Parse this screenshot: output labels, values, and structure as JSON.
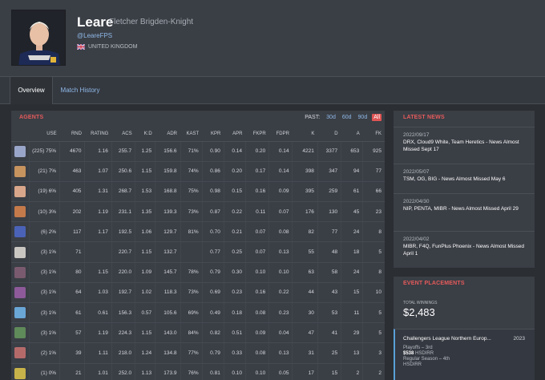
{
  "player": {
    "alias": "Leare",
    "real_name": "Fletcher Brigden-Knight",
    "twitter": "@LeareFPS",
    "country": "UNITED KINGDOM"
  },
  "tabs": [
    {
      "label": "Overview",
      "active": true
    },
    {
      "label": "Match History",
      "active": false
    }
  ],
  "agents": {
    "title": "AGENTS",
    "past_label": "PAST:",
    "past_options": [
      "30d",
      "60d",
      "90d",
      "All"
    ],
    "past_selected": "All",
    "columns": [
      "",
      "USE",
      "RND",
      "RATING",
      "ACS",
      "K:D",
      "ADR",
      "KAST",
      "KPR",
      "APR",
      "FKPR",
      "FDPR",
      "K",
      "D",
      "A",
      "FK"
    ],
    "rows": [
      {
        "icon": "sova-icon",
        "color": "#9aa6c9",
        "use": "(225) 75%",
        "rnd": "4670",
        "rating": "1.16",
        "acs": "255.7",
        "kd": "1.25",
        "adr": "156.6",
        "kast": "71%",
        "kpr": "0.90",
        "apr": "0.14",
        "fkpr": "0.20",
        "fdpr": "0.14",
        "k": "4221",
        "d": "3377",
        "a": "653",
        "fk": "925"
      },
      {
        "icon": "breach-icon",
        "color": "#c7935e",
        "use": "(21) 7%",
        "rnd": "463",
        "rating": "1.07",
        "acs": "250.6",
        "kd": "1.15",
        "adr": "159.8",
        "kast": "74%",
        "kpr": "0.86",
        "apr": "0.20",
        "fkpr": "0.17",
        "fdpr": "0.14",
        "k": "398",
        "d": "347",
        "a": "94",
        "fk": "77"
      },
      {
        "icon": "skye-icon",
        "color": "#d8a68a",
        "use": "(19) 6%",
        "rnd": "405",
        "rating": "1.31",
        "acs": "268.7",
        "kd": "1.53",
        "adr": "168.8",
        "kast": "75%",
        "kpr": "0.98",
        "apr": "0.15",
        "fkpr": "0.16",
        "fdpr": "0.09",
        "k": "395",
        "d": "259",
        "a": "61",
        "fk": "66"
      },
      {
        "icon": "kayo-icon",
        "color": "#c47a4a",
        "use": "(10) 3%",
        "rnd": "202",
        "rating": "1.19",
        "acs": "231.1",
        "kd": "1.35",
        "adr": "139.3",
        "kast": "73%",
        "kpr": "0.87",
        "apr": "0.22",
        "fkpr": "0.11",
        "fdpr": "0.07",
        "k": "176",
        "d": "130",
        "a": "45",
        "fk": "23"
      },
      {
        "icon": "neon-icon",
        "color": "#4a63b8",
        "use": "(6) 2%",
        "rnd": "117",
        "rating": "1.17",
        "acs": "192.5",
        "kd": "1.06",
        "adr": "129.7",
        "kast": "81%",
        "kpr": "0.70",
        "apr": "0.21",
        "fkpr": "0.07",
        "fdpr": "0.08",
        "k": "82",
        "d": "77",
        "a": "24",
        "fk": "8"
      },
      {
        "icon": "sage-icon",
        "color": "#c9c6c2",
        "use": "(3) 1%",
        "rnd": "71",
        "rating": "",
        "acs": "220.7",
        "kd": "1.15",
        "adr": "132.7",
        "kast": "",
        "kpr": "0.77",
        "apr": "0.25",
        "fkpr": "0.07",
        "fdpr": "0.13",
        "k": "55",
        "d": "48",
        "a": "18",
        "fk": "5"
      },
      {
        "icon": "fade-icon",
        "color": "#7a5a6e",
        "use": "(3) 1%",
        "rnd": "80",
        "rating": "1.15",
        "acs": "220.0",
        "kd": "1.09",
        "adr": "145.7",
        "kast": "78%",
        "kpr": "0.79",
        "apr": "0.30",
        "fkpr": "0.10",
        "fdpr": "0.10",
        "k": "63",
        "d": "58",
        "a": "24",
        "fk": "8"
      },
      {
        "icon": "reyna-icon",
        "color": "#8e5a9a",
        "use": "(3) 1%",
        "rnd": "64",
        "rating": "1.03",
        "acs": "192.7",
        "kd": "1.02",
        "adr": "118.3",
        "kast": "73%",
        "kpr": "0.69",
        "apr": "0.23",
        "fkpr": "0.16",
        "fdpr": "0.22",
        "k": "44",
        "d": "43",
        "a": "15",
        "fk": "10"
      },
      {
        "icon": "jett-icon",
        "color": "#6aa6d6",
        "use": "(3) 1%",
        "rnd": "61",
        "rating": "0.61",
        "acs": "156.3",
        "kd": "0.57",
        "adr": "105.6",
        "kast": "69%",
        "kpr": "0.49",
        "apr": "0.18",
        "fkpr": "0.08",
        "fdpr": "0.23",
        "k": "30",
        "d": "53",
        "a": "11",
        "fk": "5"
      },
      {
        "icon": "chamber-icon",
        "color": "#5f8a5a",
        "use": "(3) 1%",
        "rnd": "57",
        "rating": "1.19",
        "acs": "224.3",
        "kd": "1.15",
        "adr": "143.0",
        "kast": "84%",
        "kpr": "0.82",
        "apr": "0.51",
        "fkpr": "0.09",
        "fdpr": "0.04",
        "k": "47",
        "d": "41",
        "a": "29",
        "fk": "5"
      },
      {
        "icon": "raze-icon",
        "color": "#b56a6a",
        "use": "(2) 1%",
        "rnd": "39",
        "rating": "1.11",
        "acs": "218.0",
        "kd": "1.24",
        "adr": "134.8",
        "kast": "77%",
        "kpr": "0.79",
        "apr": "0.33",
        "fkpr": "0.08",
        "fdpr": "0.13",
        "k": "31",
        "d": "25",
        "a": "13",
        "fk": "3"
      },
      {
        "icon": "killjoy-icon",
        "color": "#c8b24a",
        "use": "(1) 0%",
        "rnd": "21",
        "rating": "1.01",
        "acs": "252.0",
        "kd": "1.13",
        "adr": "173.9",
        "kast": "76%",
        "kpr": "0.81",
        "apr": "0.10",
        "fkpr": "0.10",
        "fdpr": "0.05",
        "k": "17",
        "d": "15",
        "a": "2",
        "fk": "2"
      }
    ]
  },
  "news": {
    "title": "LATEST NEWS",
    "items": [
      {
        "date": "2022/09/17",
        "title": "DRX, Cloud9 White, Team Heretics - News Almost Missed Sept 17"
      },
      {
        "date": "2022/05/07",
        "title": "TSM, OG, BIG - News Almost Missed May 6"
      },
      {
        "date": "2022/04/30",
        "title": "NIP, PENTA, MIBR - News Almost Missed April 29"
      },
      {
        "date": "2022/04/02",
        "title": "MIBR, F4Q, FunPlus Phoenix - News Almost Missed April 1"
      }
    ]
  },
  "placements": {
    "title": "EVENT PLACEMENTS",
    "total_label": "TOTAL WINNINGS",
    "total_value": "$2,483",
    "event": {
      "name": "Challengers League Northern Europ...",
      "year": "2023",
      "stage1": "Playoffs – 3rd",
      "prize": "$538",
      "team1": "HSDIRR",
      "stage2": "Regular Season – 4th",
      "team2": "HSDIRR"
    }
  }
}
